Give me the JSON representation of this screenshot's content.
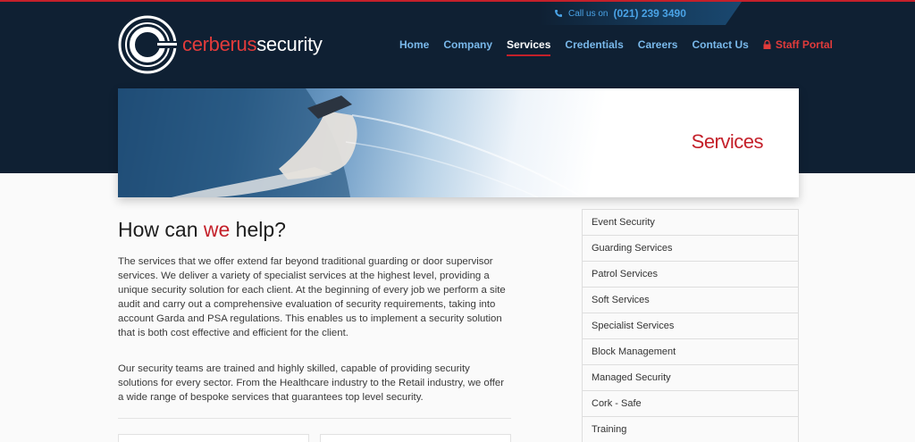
{
  "header": {
    "phone_prefix": "Call us on",
    "phone_number": "(021) 239 3490",
    "logo_text_red": "cerberus",
    "logo_text_white": "security"
  },
  "nav": {
    "items": [
      {
        "label": "Home"
      },
      {
        "label": "Company"
      },
      {
        "label": "Services"
      },
      {
        "label": "Credentials"
      },
      {
        "label": "Careers"
      },
      {
        "label": "Contact Us"
      }
    ],
    "active": "Services",
    "staff_portal": "Staff Portal"
  },
  "banner": {
    "title": "Services"
  },
  "main": {
    "heading_pre": "How can ",
    "heading_red": "we",
    "heading_post": " help?",
    "paragraph1": "The services that we offer extend far beyond traditional guarding or door supervisor services. We deliver a variety of specialist services at the highest level, providing a unique security solution for each client. At the beginning of every job we perform a site audit and carry out a comprehensive evaluation of security requirements, taking into account Garda and PSA regulations. This enables us to implement a security solution that is both cost effective and efficient for the client.",
    "paragraph2": "Our security teams are trained and highly skilled, capable of providing security solutions for every sector. From the Healthcare industry to the Retail industry, we offer a wide range of bespoke services that guarantees top level security."
  },
  "sidebar": {
    "items": [
      {
        "label": "Event Security"
      },
      {
        "label": "Guarding Services"
      },
      {
        "label": "Patrol Services"
      },
      {
        "label": "Soft Services"
      },
      {
        "label": "Specialist Services"
      },
      {
        "label": "Block Management"
      },
      {
        "label": "Managed Security"
      },
      {
        "label": "Cork - Safe"
      },
      {
        "label": "Training"
      }
    ]
  },
  "colors": {
    "header_bg": "#0f2033",
    "accent_red": "#c4202a",
    "nav_link": "#79b8ea"
  },
  "icons": [
    "phone-icon",
    "lock-icon",
    "cerberus-logo-icon"
  ]
}
